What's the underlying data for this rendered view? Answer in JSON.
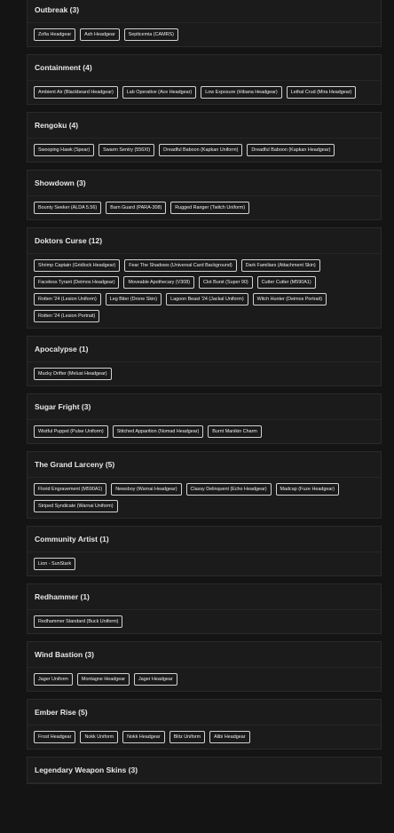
{
  "groups": [
    {
      "title": "Outbreak (3)",
      "items": [
        "Zofia Headgear",
        "Ash Headgear",
        "Septicemia (CAMRS)"
      ]
    },
    {
      "title": "Containment (4)",
      "items": [
        "Ambient Air (Blackbeard Headgear)",
        "Lab Operative (Ace Headgear)",
        "Low Exposure (Hibana Headgear)",
        "Lethal Crud (Mira Headgear)"
      ]
    },
    {
      "title": "Rengoku (4)",
      "items": [
        "Swooping Hawk (Spear)",
        "Swarm Sentry (556XI)",
        "Dreadful Baboon (Kapkan Uniform)",
        "Dreadful Baboon (Kapkan Headgear)"
      ]
    },
    {
      "title": "Showdown (3)",
      "items": [
        "Bounty Seeker (ALDA 5.56)",
        "Barn Guard (PARA-308)",
        "Rugged Ranger (Twitch Uniform)"
      ]
    },
    {
      "title": "Doktors Curse (12)",
      "items": [
        "Shrimp Captain (Gridlock Headgear)",
        "Fear The Shadows (Universal Card Background)",
        "Dark Familiars (Attachment Skin)",
        "Faceless Tyrant (Deimos Headgear)",
        "Moveable Apothecary (V308)",
        "Clot Burst (Super 90)",
        "Cutter Cutter (M590A1)",
        "Rotten '24 (Lesion Uniform)",
        "Leg Biter (Drone Skin)",
        "Lagoon Beast '24 (Jackal Uniform)",
        "Witch Hunter (Deimos Portrait)",
        "Rotten '24 (Lesion Portrait)"
      ]
    },
    {
      "title": "Apocalypse (1)",
      "items": [
        "Mucky Drifter (Melusi Headgear)"
      ]
    },
    {
      "title": "Sugar Fright (3)",
      "items": [
        "Wistful Puppet (Pulse Uniform)",
        "Stitched Apparition (Nomad Headgear)",
        "Burnt Manikin Charm"
      ]
    },
    {
      "title": "The Grand Larceny (5)",
      "items": [
        "Florid Engravement (M590A1)",
        "Newsboy (Warnai Headgear)",
        "Classy Delinquent (Echo Headgear)",
        "Madcap (Fuze Headgear)",
        "Striped Syndicate (Warnai Uniform)"
      ]
    },
    {
      "title": "Community Artist (1)",
      "items": [
        "Lion - SunStark"
      ]
    },
    {
      "title": "Redhammer (1)",
      "items": [
        "Redhammer Standard (Buck Uniform)"
      ]
    },
    {
      "title": "Wind Bastion (3)",
      "items": [
        "Jager Uniform",
        "Montagne Headgear",
        "Jager Headgear"
      ]
    },
    {
      "title": "Ember Rise (5)",
      "items": [
        "Frost Headgear",
        "Nokk Uniform",
        "Nokk Headgear",
        "Blitz Uniform",
        "Alibi Headgear"
      ]
    },
    {
      "title": "Legendary Weapon Skins (3)",
      "items": []
    }
  ]
}
